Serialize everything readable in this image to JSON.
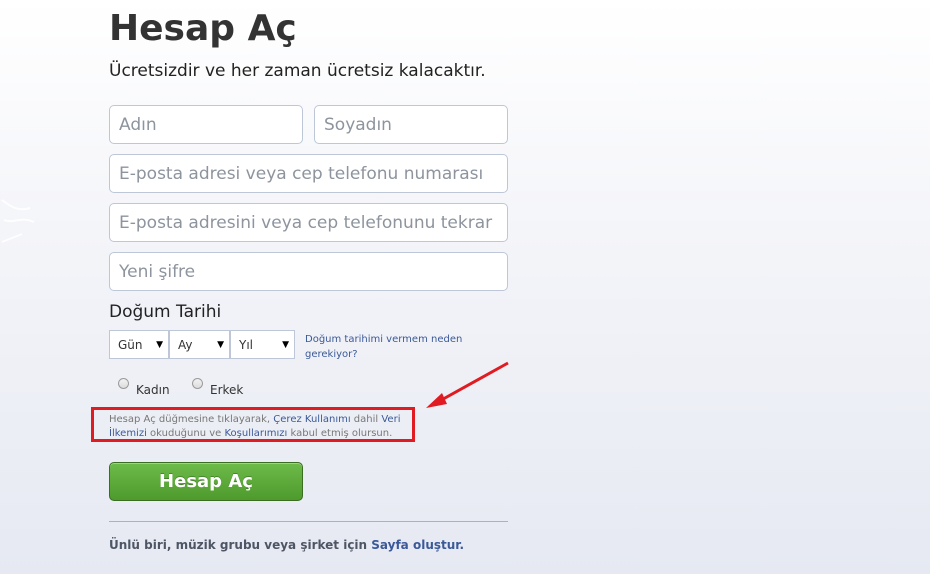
{
  "header": {
    "title": "Hesap Aç",
    "subtitle": "Ücretsizdir ve her zaman ücretsiz kalacaktır."
  },
  "form": {
    "first_name_placeholder": "Adın",
    "last_name_placeholder": "Soyadın",
    "email_placeholder": "E-posta adresi veya cep telefonu numarası",
    "email_confirm_placeholder": "E-posta adresini veya cep telefonunu tekrar gir",
    "password_placeholder": "Yeni şifre",
    "birthday_label": "Doğum Tarihi",
    "day_select": "Gün",
    "month_select": "Ay",
    "year_select": "Yıl",
    "why_birthday_link": "Doğum tarihimi vermem neden gerekiyor?",
    "gender_female": "Kadın",
    "gender_male": "Erkek",
    "terms_part1": "Hesap Aç düğmesine tıklayarak, ",
    "terms_link_cookies": "Çerez Kullanımı",
    "terms_part2": " dahil ",
    "terms_link_data": "Veri İlkemizi",
    "terms_part3": " okuduğunu ve ",
    "terms_link_terms": "Koşullarımızı",
    "terms_part4": " kabul etmiş olursun.",
    "submit_label": "Hesap Aç"
  },
  "footer": {
    "create_page_text": "Ünlü biri, müzik grubu veya şirket için ",
    "create_page_link": "Sayfa oluştur."
  },
  "icons": {
    "select_caret": "▼"
  },
  "colors": {
    "link": "#3b5998",
    "submit_green": "#5fae3c",
    "annotation_red": "#e01b22"
  }
}
